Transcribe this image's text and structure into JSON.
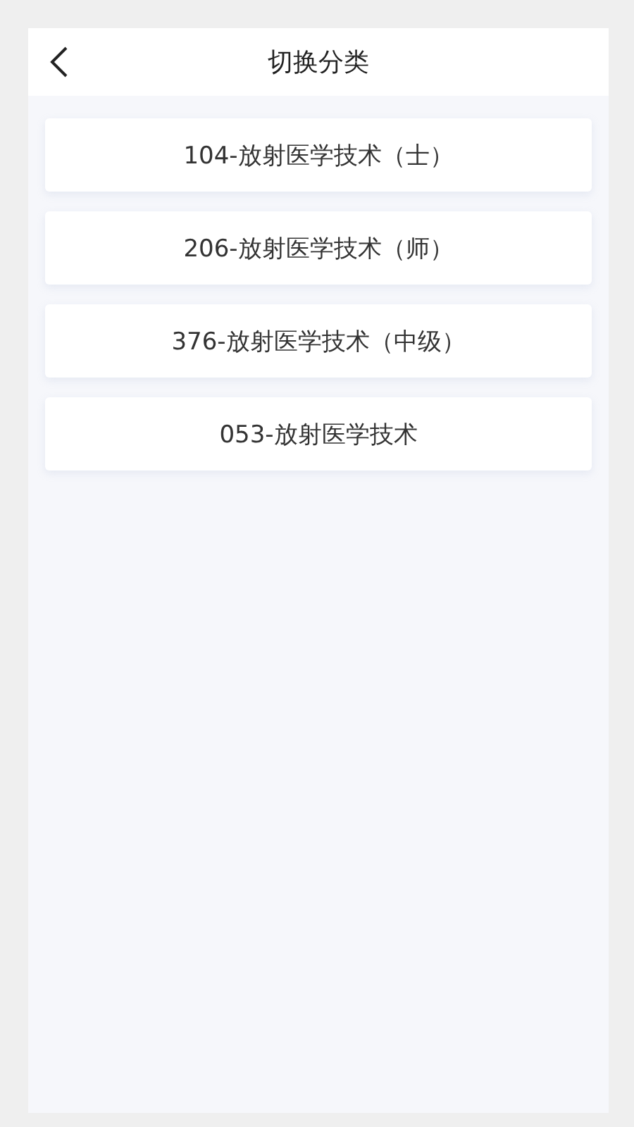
{
  "header": {
    "title": "切换分类"
  },
  "categories": [
    {
      "label": "104-放射医学技术（士）"
    },
    {
      "label": "206-放射医学技术（师）"
    },
    {
      "label": "376-放射医学技术（中级）"
    },
    {
      "label": "053-放射医学技术"
    }
  ]
}
